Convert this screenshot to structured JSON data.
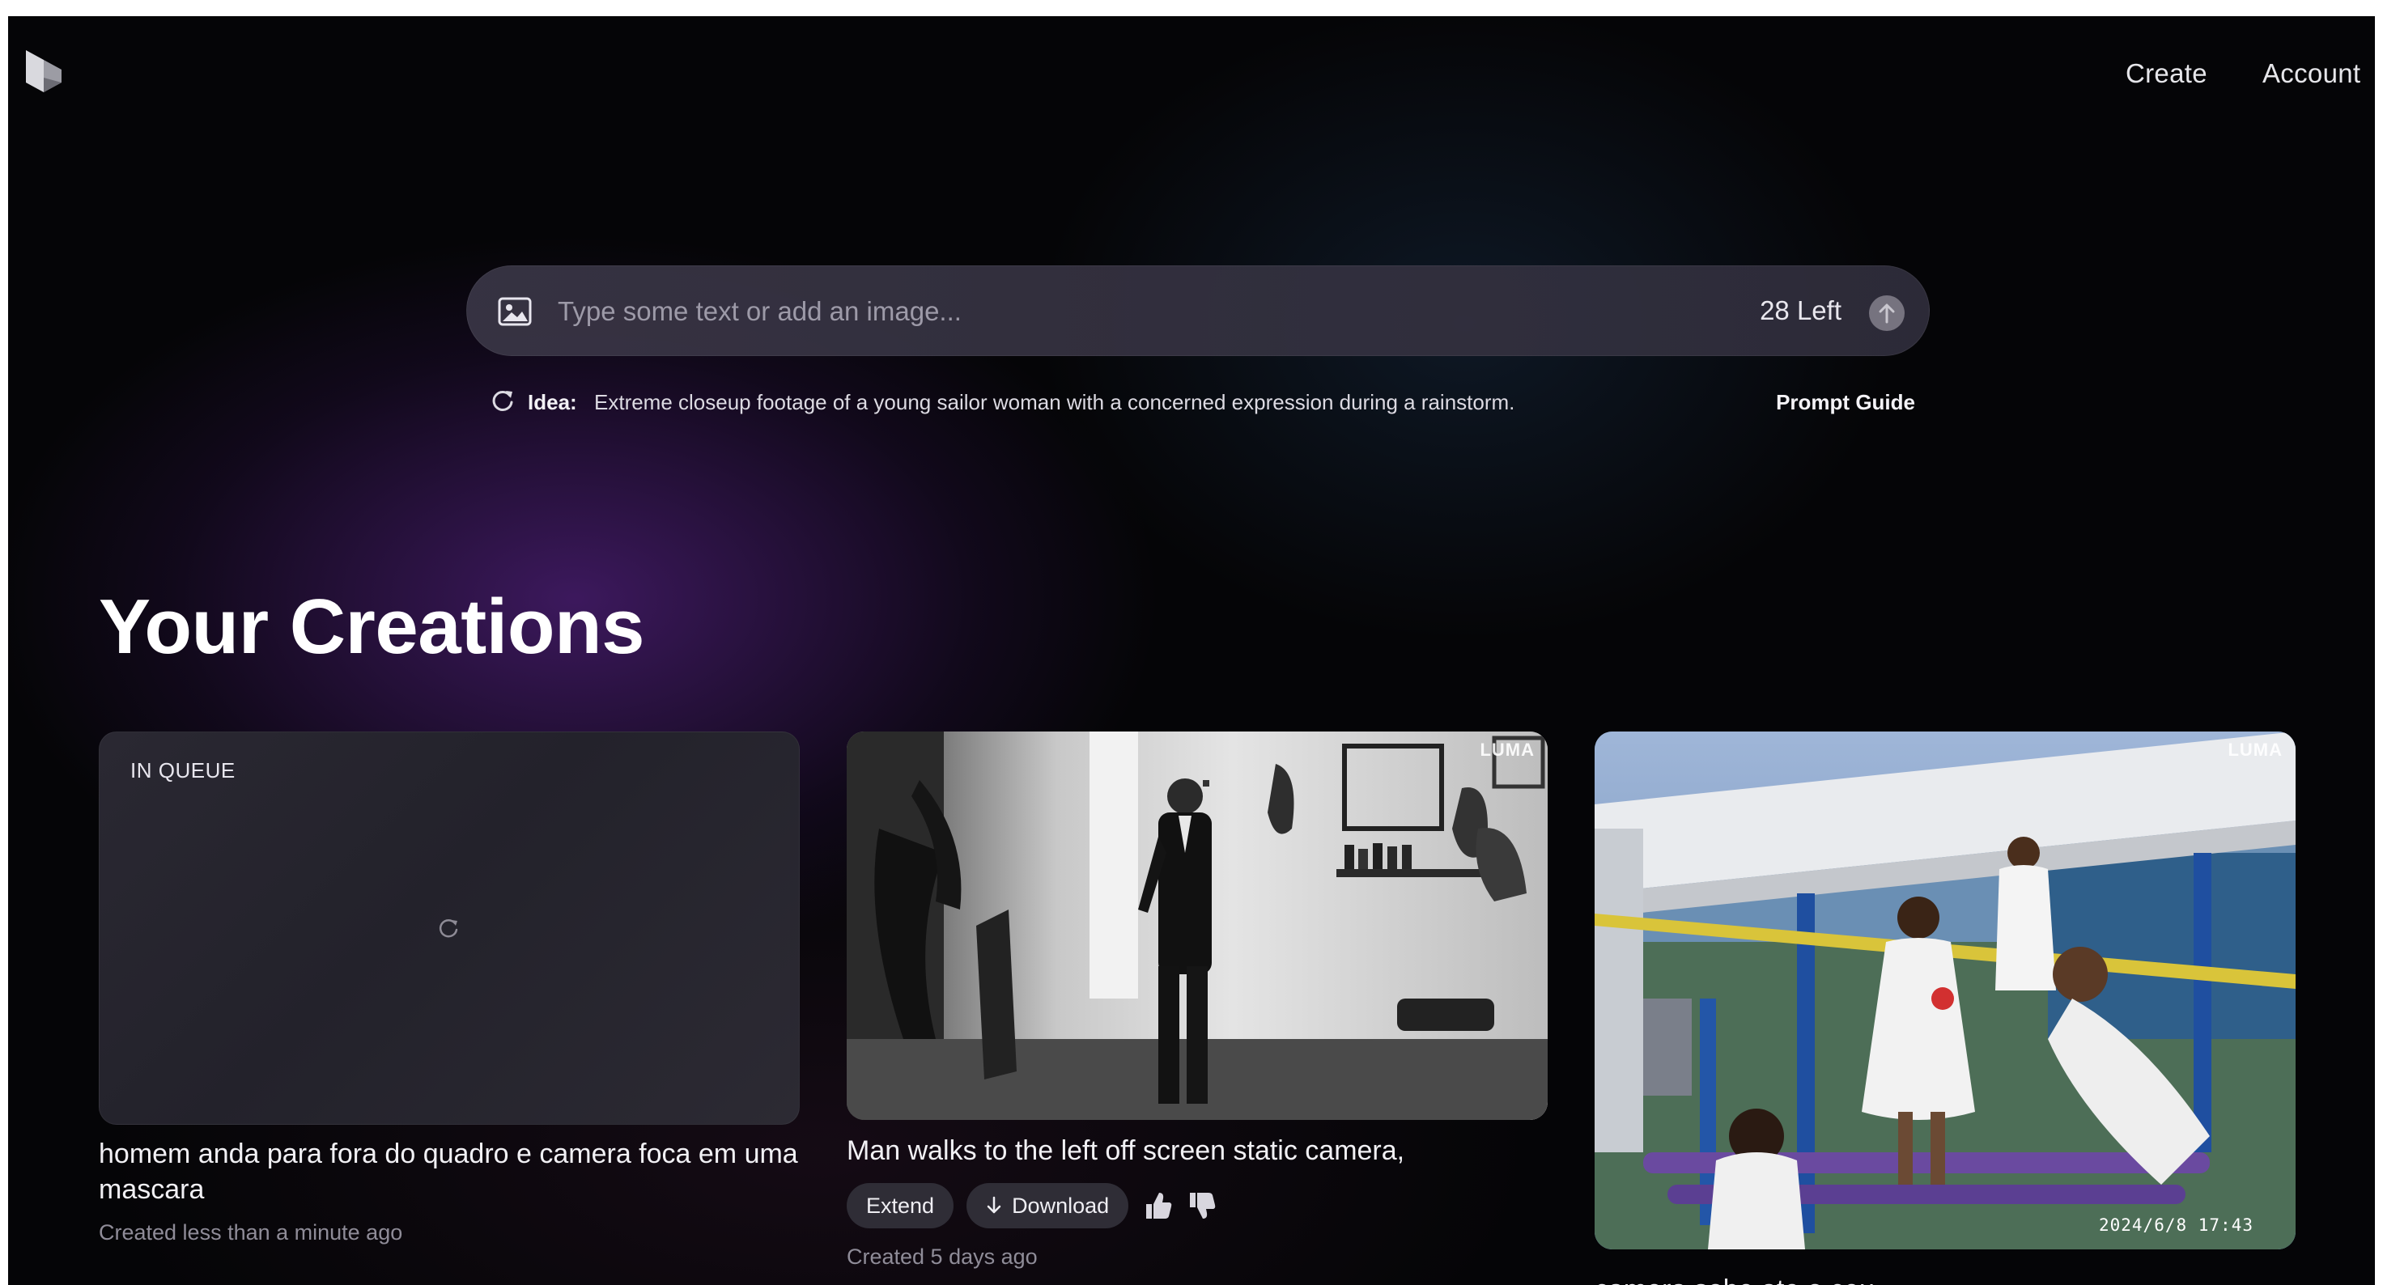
{
  "header": {
    "logo": "luma-logo-icon",
    "nav": {
      "create": "Create",
      "account": "Account"
    }
  },
  "prompt": {
    "placeholder": "Type some text or add an image...",
    "value": "",
    "left_count": "28 Left",
    "image_icon": "image-icon",
    "submit_icon": "arrow-up-icon"
  },
  "idea": {
    "label": "Idea:",
    "text": "Extreme closeup footage of a young sailor woman with a concerned expression during a rainstorm.",
    "prompt_guide": "Prompt Guide"
  },
  "section": {
    "title": "Your Creations"
  },
  "creations": [
    {
      "status": "IN QUEUE",
      "caption": "homem anda para fora do quadro e camera foca em uma mascara",
      "created": "Created less than a minute ago"
    },
    {
      "watermark": "LUMA",
      "caption": "Man walks to the left off screen static camera,",
      "extend_label": "Extend",
      "download_label": "Download",
      "created": "Created 5 days ago"
    },
    {
      "watermark": "LUMA",
      "timestamp": "2024/6/8 17:43",
      "caption": "camera sobe ate o ceu"
    }
  ],
  "colors": {
    "background": "#050507",
    "accent_purple": "#461c6c",
    "pill_bg": "#2f2d36",
    "muted_text": "#8f8c98"
  }
}
